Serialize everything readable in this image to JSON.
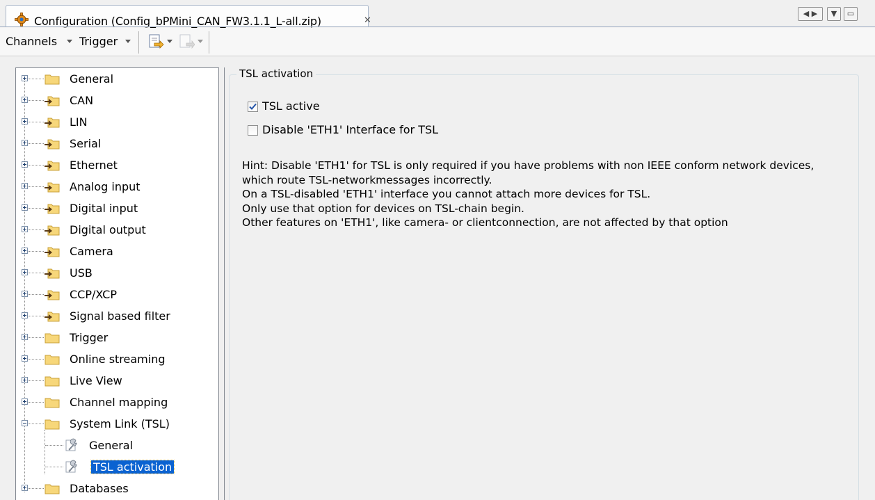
{
  "tab": {
    "title": "Configuration (Config_bPMini_CAN_FW3.1.1_L-all.zip)",
    "close_glyph": "✕",
    "icon": "gear-icon"
  },
  "window_controls": [
    "◀ ▶",
    "▼",
    "▭"
  ],
  "toolbar": {
    "channels_label": "Channels",
    "trigger_label": "Trigger"
  },
  "tree": {
    "items": [
      {
        "label": "General",
        "icon": "folder-icon"
      },
      {
        "label": "CAN",
        "icon": "plug-folder-icon"
      },
      {
        "label": "LIN",
        "icon": "plug-folder-icon"
      },
      {
        "label": "Serial",
        "icon": "plug-folder-icon"
      },
      {
        "label": "Ethernet",
        "icon": "plug-folder-icon"
      },
      {
        "label": "Analog input",
        "icon": "plug-folder-icon"
      },
      {
        "label": "Digital input",
        "icon": "plug-folder-icon"
      },
      {
        "label": "Digital output",
        "icon": "plug-folder-icon"
      },
      {
        "label": "Camera",
        "icon": "plug-folder-icon"
      },
      {
        "label": "USB",
        "icon": "plug-folder-icon"
      },
      {
        "label": "CCP/XCP",
        "icon": "plug-folder-icon"
      },
      {
        "label": "Signal based filter",
        "icon": "plug-folder-icon"
      },
      {
        "label": "Trigger",
        "icon": "folder-icon"
      },
      {
        "label": "Online streaming",
        "icon": "folder-icon"
      },
      {
        "label": "Live View",
        "icon": "folder-icon"
      },
      {
        "label": "Channel mapping",
        "icon": "folder-icon"
      },
      {
        "label": "System Link (TSL)",
        "icon": "folder-icon",
        "expanded": true,
        "children": [
          {
            "label": "General",
            "icon": "wrench-icon"
          },
          {
            "label": "TSL activation",
            "icon": "wrench-icon",
            "selected": true
          }
        ]
      },
      {
        "label": "Databases",
        "icon": "folder-icon"
      }
    ]
  },
  "panel": {
    "group_title": "TSL activation",
    "tsl_active": {
      "label": "TSL active",
      "checked": true
    },
    "disable_eth1": {
      "label": "Disable 'ETH1' Interface for TSL",
      "checked": false
    },
    "hint_lines": [
      "Hint: Disable 'ETH1' for TSL is only required if you have problems with non IEEE conform network devices,",
      "which route TSL-networkmessages incorrectly.",
      "On a TSL-disabled 'ETH1' interface you cannot attach more devices for TSL.",
      "Only use that option for devices on TSL-chain begin.",
      "Other features on 'ETH1', like camera- or clientconnection, are not affected by that option"
    ]
  }
}
